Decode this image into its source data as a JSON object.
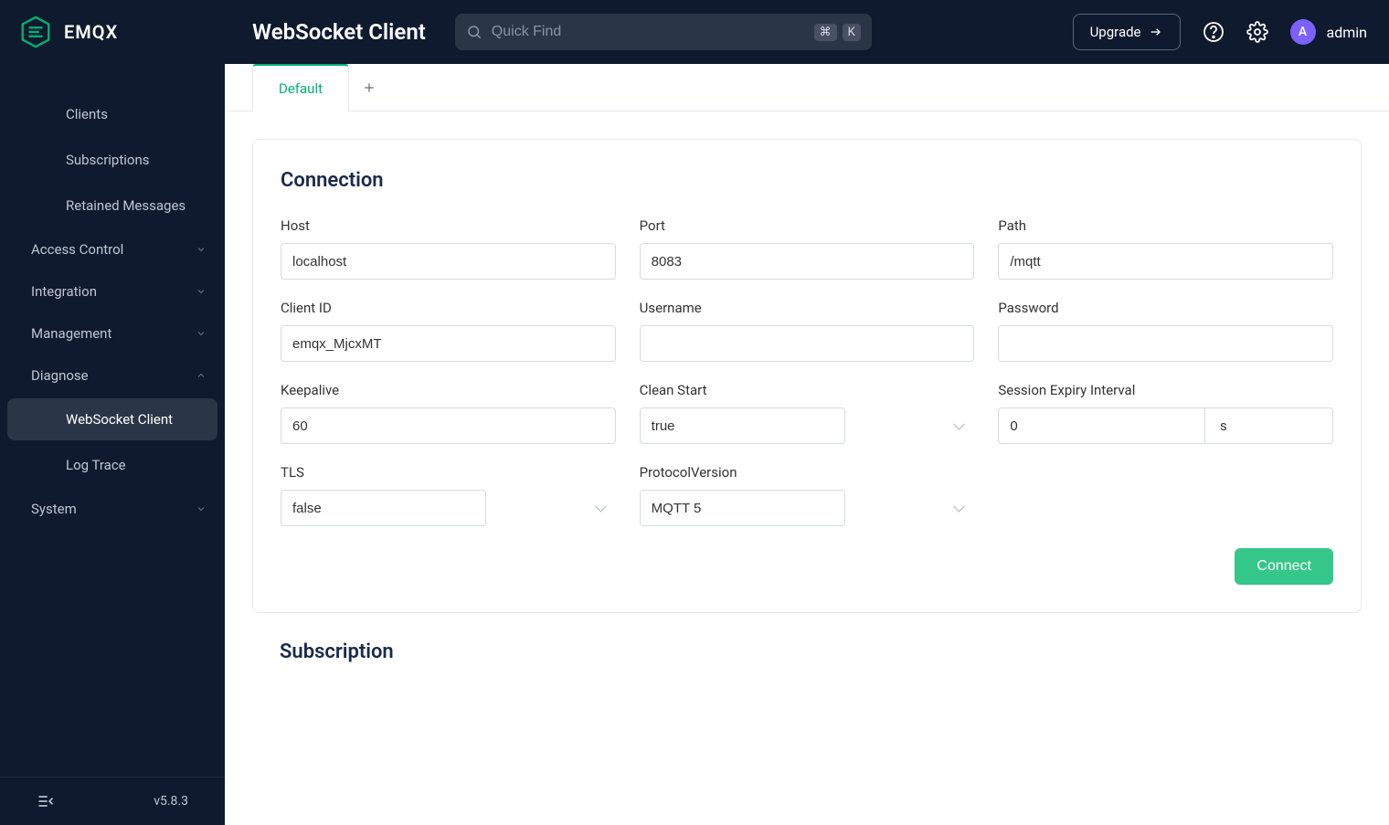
{
  "header": {
    "brand": "EMQX",
    "page_title": "WebSocket Client",
    "search_placeholder": "Quick Find",
    "kbd1": "⌘",
    "kbd2": "K",
    "upgrade_label": "Upgrade",
    "user_initial": "A",
    "username": "admin"
  },
  "sidebar": {
    "items": [
      {
        "label": "Clients"
      },
      {
        "label": "Subscriptions"
      },
      {
        "label": "Retained Messages"
      }
    ],
    "groups": [
      {
        "label": "Access Control",
        "expanded": false
      },
      {
        "label": "Integration",
        "expanded": false
      },
      {
        "label": "Management",
        "expanded": false
      },
      {
        "label": "Diagnose",
        "expanded": true,
        "children": [
          "WebSocket Client",
          "Log Trace"
        ],
        "active_child": 0
      },
      {
        "label": "System",
        "expanded": false
      }
    ],
    "version": "v5.8.3"
  },
  "tabs": {
    "active": "Default"
  },
  "connection": {
    "title": "Connection",
    "fields": {
      "host": {
        "label": "Host",
        "value": "localhost"
      },
      "port": {
        "label": "Port",
        "value": "8083"
      },
      "path": {
        "label": "Path",
        "value": "/mqtt"
      },
      "client_id": {
        "label": "Client ID",
        "value": "emqx_MjcxMT"
      },
      "username": {
        "label": "Username",
        "value": ""
      },
      "password": {
        "label": "Password",
        "value": ""
      },
      "keepalive": {
        "label": "Keepalive",
        "value": "60"
      },
      "clean_start": {
        "label": "Clean Start",
        "value": "true"
      },
      "session_expiry": {
        "label": "Session Expiry Interval",
        "value": "0",
        "unit": "s"
      },
      "tls": {
        "label": "TLS",
        "value": "false"
      },
      "protocol_version": {
        "label": "ProtocolVersion",
        "value": "MQTT 5"
      }
    },
    "connect_label": "Connect"
  },
  "subscription": {
    "title": "Subscription"
  }
}
